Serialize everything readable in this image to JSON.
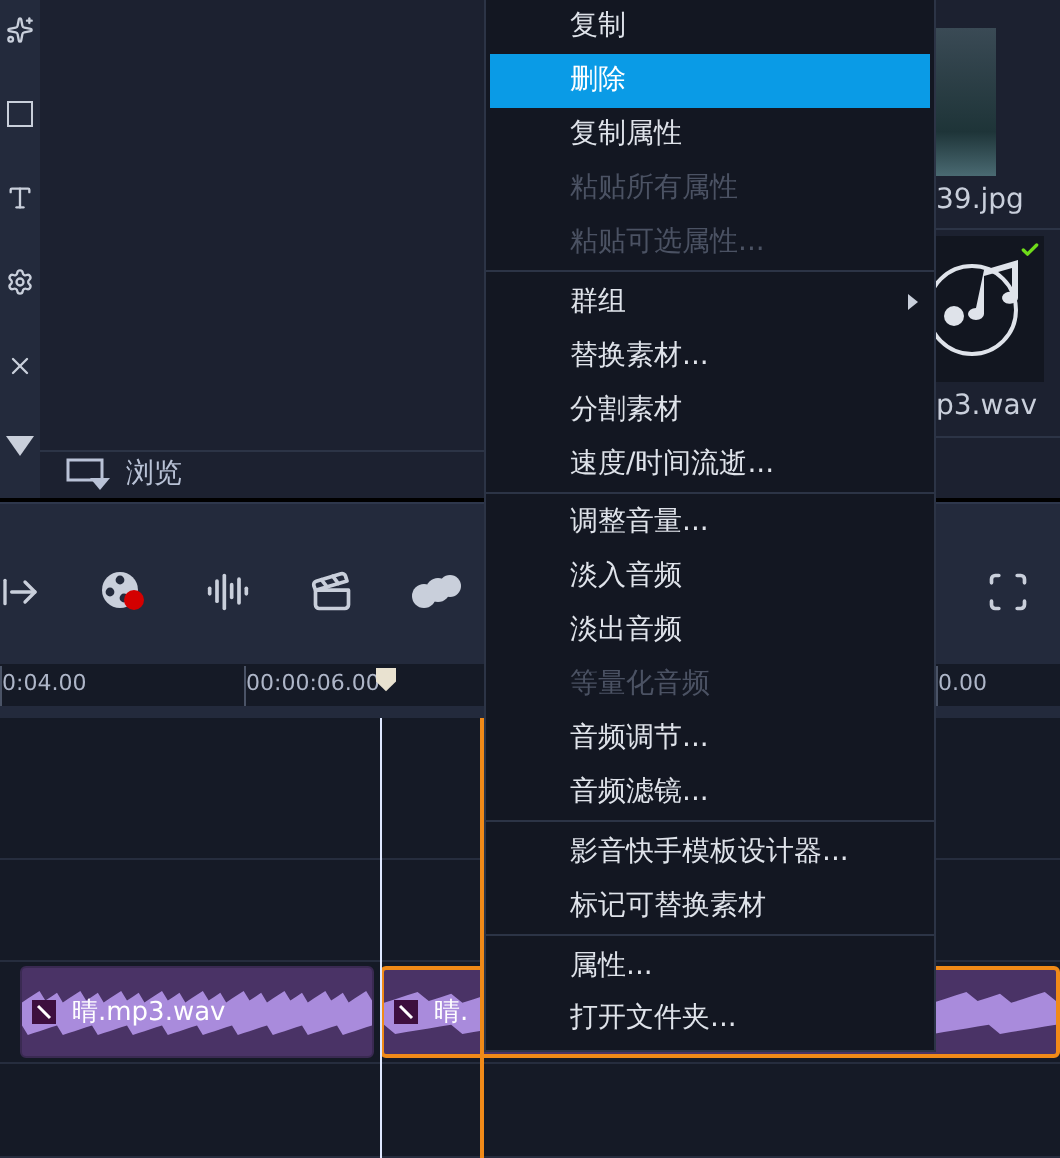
{
  "media_panel": {
    "browse_label": "浏览"
  },
  "library": {
    "thumbnails": [
      {
        "kind": "photo",
        "caption": "39.jpg",
        "checked": false
      },
      {
        "kind": "audio",
        "caption": "p3.wav",
        "checked": true
      }
    ]
  },
  "ruler": {
    "labels": [
      "0:04.00",
      "00:00:06.00",
      "0.00"
    ]
  },
  "timeline": {
    "clips": [
      {
        "name": "晴.mp3.wav",
        "selected": false
      },
      {
        "name": "晴.",
        "selected": true
      }
    ]
  },
  "context_menu": {
    "items": [
      {
        "kind": "item",
        "label": "复制",
        "selected": false,
        "disabled": false,
        "submenu": false
      },
      {
        "kind": "item",
        "label": "删除",
        "selected": true,
        "disabled": false,
        "submenu": false
      },
      {
        "kind": "item",
        "label": "复制属性",
        "selected": false,
        "disabled": false,
        "submenu": false
      },
      {
        "kind": "item",
        "label": "粘贴所有属性",
        "selected": false,
        "disabled": true,
        "submenu": false
      },
      {
        "kind": "item",
        "label": "粘贴可选属性...",
        "selected": false,
        "disabled": true,
        "submenu": false
      },
      {
        "kind": "separator"
      },
      {
        "kind": "item",
        "label": "群组",
        "selected": false,
        "disabled": false,
        "submenu": true
      },
      {
        "kind": "item",
        "label": "替换素材...",
        "selected": false,
        "disabled": false,
        "submenu": false
      },
      {
        "kind": "item",
        "label": "分割素材",
        "selected": false,
        "disabled": false,
        "submenu": false
      },
      {
        "kind": "item",
        "label": "速度/时间流逝...",
        "selected": false,
        "disabled": false,
        "submenu": false
      },
      {
        "kind": "separator"
      },
      {
        "kind": "item",
        "label": "调整音量...",
        "selected": false,
        "disabled": false,
        "submenu": false
      },
      {
        "kind": "item",
        "label": "淡入音频",
        "selected": false,
        "disabled": false,
        "submenu": false
      },
      {
        "kind": "item",
        "label": "淡出音频",
        "selected": false,
        "disabled": false,
        "submenu": false
      },
      {
        "kind": "item",
        "label": "等量化音频",
        "selected": false,
        "disabled": true,
        "submenu": false
      },
      {
        "kind": "item",
        "label": "音频调节...",
        "selected": false,
        "disabled": false,
        "submenu": false
      },
      {
        "kind": "item",
        "label": "音频滤镜...",
        "selected": false,
        "disabled": false,
        "submenu": false
      },
      {
        "kind": "separator"
      },
      {
        "kind": "item",
        "label": "影音快手模板设计器...",
        "selected": false,
        "disabled": false,
        "submenu": false
      },
      {
        "kind": "item",
        "label": "标记可替换素材",
        "selected": false,
        "disabled": false,
        "submenu": false
      },
      {
        "kind": "separator"
      },
      {
        "kind": "item",
        "label": "属性...",
        "selected": false,
        "disabled": false,
        "submenu": false
      },
      {
        "kind": "item",
        "label": "打开文件夹...",
        "selected": false,
        "disabled": false,
        "submenu": false
      }
    ]
  }
}
